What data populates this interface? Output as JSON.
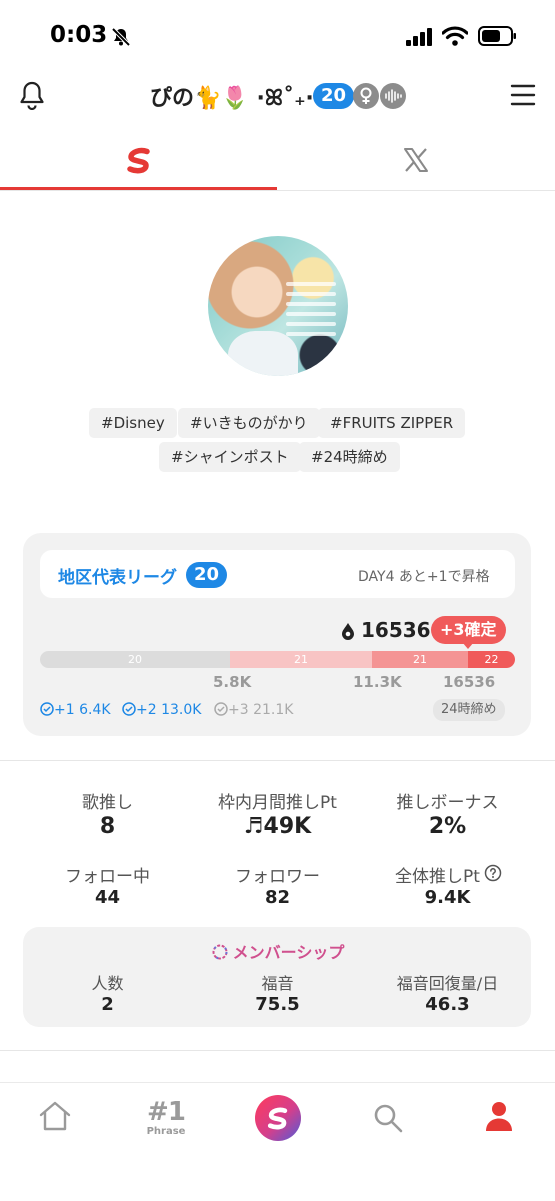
{
  "status_bar": {
    "time": "0:03"
  },
  "header": {
    "display_name": "ぴの🐈🌷 ·ꕤ˚₊‧",
    "level": "20"
  },
  "tabs": [
    {
      "name": "app"
    },
    {
      "name": "x"
    }
  ],
  "tags": [
    "#Disney",
    "#いきものがかり",
    "#FRUITS ZIPPER",
    "#シャインポスト",
    "#24時締め"
  ],
  "league": {
    "title": "地区代表リーグ",
    "level": "20",
    "day_info": "DAY4 あと+1で昇格",
    "points": "16536",
    "confirm_label": "+3確定",
    "bar_segments": [
      "20",
      "21",
      "21",
      "22"
    ],
    "thresholds": [
      "5.8K",
      "11.3K",
      "16536"
    ],
    "rewards": [
      {
        "label": "+1 6.4K",
        "achieved": true
      },
      {
        "label": "+2 13.0K",
        "achieved": true
      },
      {
        "label": "+3 21.1K",
        "achieved": false
      }
    ],
    "deadline": "24時締め"
  },
  "stats": [
    {
      "label": "歌推し",
      "value": "8"
    },
    {
      "label": "枠内月間推しPt",
      "value": "♬49K"
    },
    {
      "label": "推しボーナス",
      "value": "2%"
    },
    {
      "label": "フォロー中",
      "value": "44"
    },
    {
      "label": "フォロワー",
      "value": "82"
    },
    {
      "label": "全体推しPt",
      "value": "9.4K"
    }
  ],
  "membership": {
    "title": "メンバーシップ",
    "items": [
      {
        "label": "人数",
        "value": "2"
      },
      {
        "label": "福音",
        "value": "75.5"
      },
      {
        "label": "福音回復量/日",
        "value": "46.3"
      }
    ]
  },
  "bottom_nav": {
    "phrase_number": "#1",
    "phrase_label": "Phrase"
  },
  "colors": {
    "accent": "#e53935",
    "league_blue": "#1e88e5",
    "membership": "#d0508e"
  }
}
